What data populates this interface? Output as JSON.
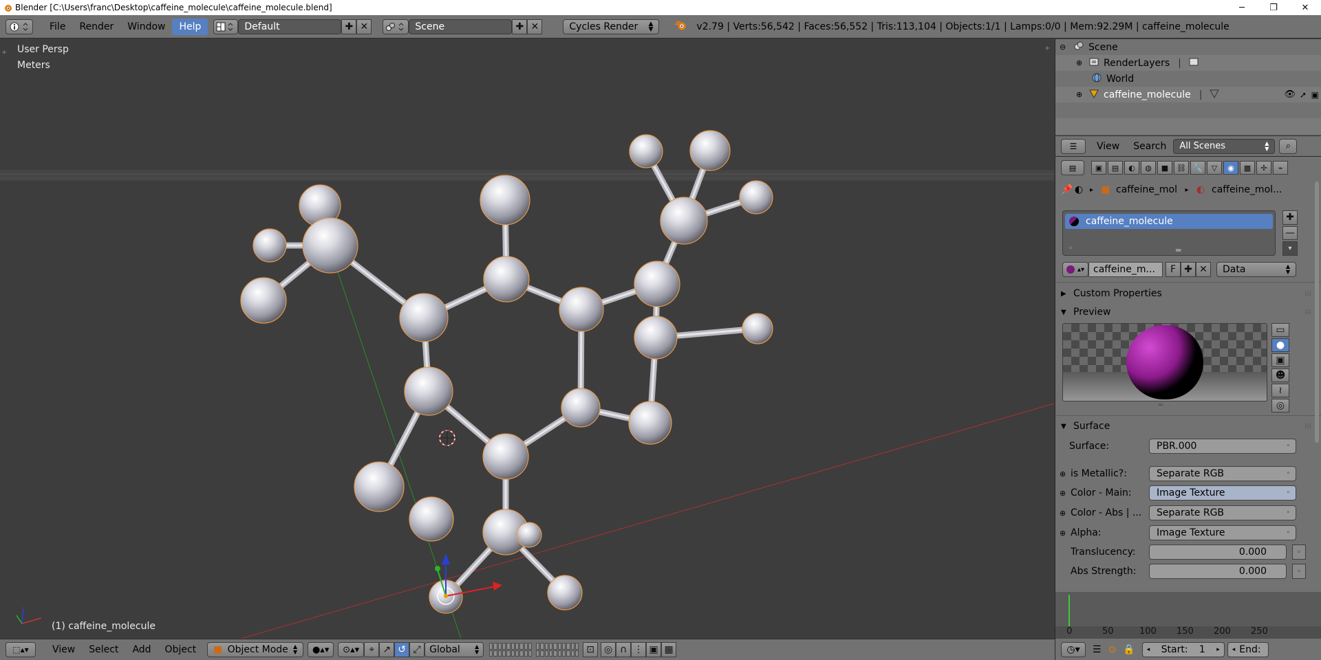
{
  "window": {
    "title": "Blender [C:\\Users\\franc\\Desktop\\caffeine_molecule\\caffeine_molecule.blend]",
    "minimize": "─",
    "maximize": "❐",
    "close": "✕"
  },
  "info_header": {
    "menus": [
      "File",
      "Render",
      "Window",
      "Help"
    ],
    "active_menu": "Help",
    "screen_layout": "Default",
    "scene": "Scene",
    "render_engine": "Cycles Render",
    "stats": "v2.79 | Verts:56,542 | Faces:56,552 | Tris:113,104 | Objects:1/1 | Lamps:0/0 | Mem:92.29M | caffeine_molecule"
  },
  "viewport": {
    "view_name": "User Persp",
    "units": "Meters",
    "active_object_label": "(1) caffeine_molecule"
  },
  "outliner": {
    "items": [
      {
        "label": "Scene",
        "icon": "scene-icon"
      },
      {
        "label": "RenderLayers",
        "icon": "renderlayers-icon"
      },
      {
        "label": "World",
        "icon": "world-icon"
      },
      {
        "label": "caffeine_molecule",
        "icon": "mesh-object-icon"
      }
    ],
    "view_label": "View",
    "search_label": "Search",
    "filter": "All Scenes"
  },
  "properties": {
    "breadcrumb_object": "caffeine_mol",
    "breadcrumb_material": "caffeine_mol...",
    "material_slot": "caffeine_molecule",
    "material_name": "caffeine_m...",
    "fake_user": "F",
    "link_mode": "Data",
    "custom_properties": "Custom Properties",
    "preview": "Preview",
    "surface_section": "Surface",
    "surface_label": "Surface:",
    "surface_value": "PBR.000",
    "inputs": [
      {
        "label": "is Metallic?:",
        "value": "Separate RGB"
      },
      {
        "label": "Color - Main:",
        "value": "Image Texture"
      },
      {
        "label": "Color - Abs | ...",
        "value": "Separate RGB"
      },
      {
        "label": "Alpha:",
        "value": "Image Texture"
      }
    ],
    "translucency_label": "Translucency:",
    "translucency_value": "0.000",
    "abs_strength_label": "Abs Strength:",
    "abs_strength_value": "0.000"
  },
  "timeline": {
    "ticks": [
      "0",
      "50",
      "100",
      "150",
      "200",
      "250"
    ],
    "start_label": "Start:",
    "start_value": "1",
    "end_label": "End:"
  },
  "bottom_header": {
    "menus": [
      "View",
      "Select",
      "Add",
      "Object"
    ],
    "mode": "Object Mode",
    "orientation": "Global"
  },
  "colors": {
    "accent": "#5680c2",
    "panel": "#727272",
    "viewport_bg": "#3d3d3d",
    "x_axis": "#b03030",
    "y_axis": "#2e8a2e",
    "material": "#7a1a7a"
  }
}
